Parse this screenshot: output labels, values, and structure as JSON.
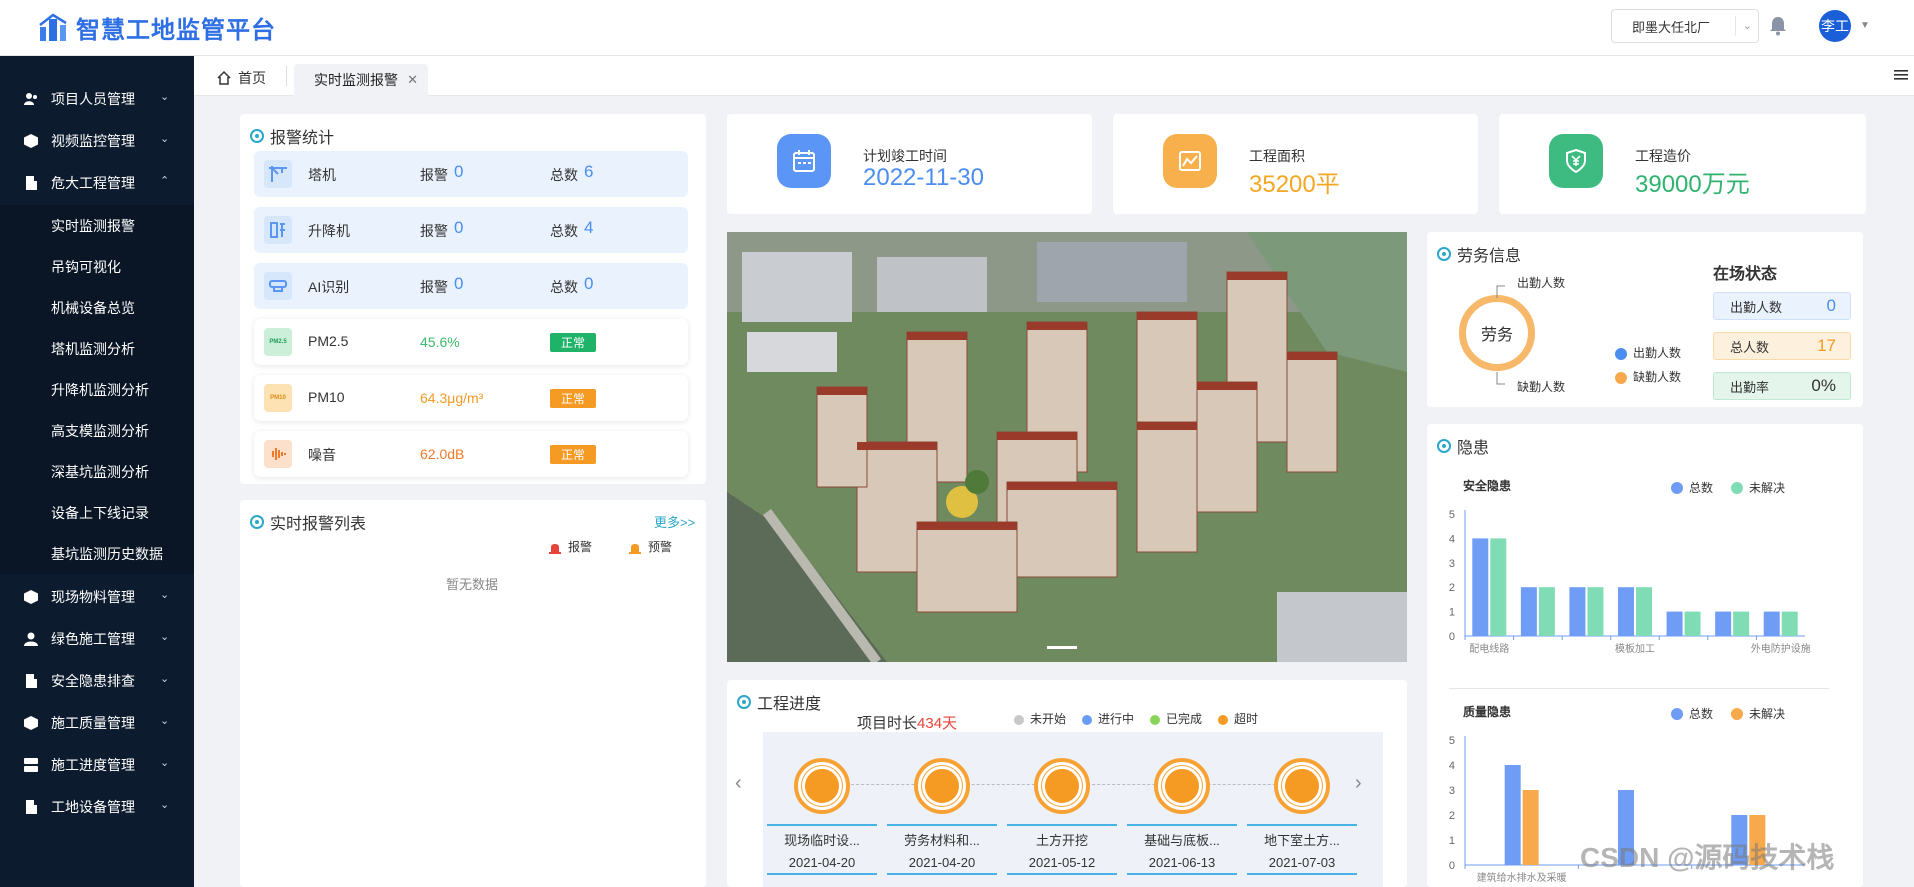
{
  "header": {
    "app_title": "智慧工地监管平台",
    "site_selector": "即墨大任北厂",
    "user": "李工"
  },
  "sidebar": {
    "items": [
      {
        "label": "项目人员管理"
      },
      {
        "label": "视频监控管理"
      },
      {
        "label": "危大工程管理"
      },
      {
        "label": "现场物料管理"
      },
      {
        "label": "绿色施工管理"
      },
      {
        "label": "安全隐患排查"
      },
      {
        "label": "施工质量管理"
      },
      {
        "label": "施工进度管理"
      },
      {
        "label": "工地设备管理"
      }
    ],
    "sub_items": [
      "实时监测报警",
      "吊钩可视化",
      "机械设备总览",
      "塔机监测分析",
      "升降机监测分析",
      "高支模监测分析",
      "深基坑监测分析",
      "设备上下线记录",
      "基坑监测历史数据"
    ]
  },
  "tabs": {
    "home": "首页",
    "active": "实时监测报警"
  },
  "alarm_stats": {
    "title": "报警统计",
    "alarm_key": "报警",
    "total_key": "总数",
    "devices": [
      {
        "name": "塔机",
        "alarm": "0",
        "total": "6"
      },
      {
        "name": "升降机",
        "alarm": "0",
        "total": "4"
      },
      {
        "name": "AI识别",
        "alarm": "0",
        "total": "0"
      }
    ],
    "env": [
      {
        "name": "PM2.5",
        "value": "45.6%",
        "status": "正常",
        "color": "#3dbb6c",
        "badge_color": "#1fb36a",
        "icon_text": "PM2.5"
      },
      {
        "name": "PM10",
        "value": "64.3μg/m³",
        "status": "正常",
        "color": "#f59a23",
        "badge_color": "#f59a23",
        "icon_text": "PM10"
      },
      {
        "name": "噪音",
        "value": "62.0dB",
        "status": "正常",
        "color": "#f07a2a",
        "badge_color": "#f59a23"
      }
    ]
  },
  "alarm_list": {
    "title": "实时报警列表",
    "more": "更多>>",
    "legend_alarm": "报警",
    "legend_warn": "预警",
    "empty": "暂无数据"
  },
  "top_stats": [
    {
      "label": "计划竣工时间",
      "value": "2022-11-30",
      "color": "#4b8ef0",
      "icon_bg": "#5b95f5"
    },
    {
      "label": "工程面积",
      "value": "35200平",
      "color": "#f5a623",
      "icon_bg": "#f8b04d"
    },
    {
      "label": "工程造价",
      "value": "39000万元",
      "color": "#2fb36f",
      "icon_bg": "#3dbb80"
    }
  ],
  "progress": {
    "title": "工程进度",
    "duration_prefix": "项目时长",
    "duration_value": "434天",
    "legend": [
      {
        "label": "未开始",
        "color": "#c8c8c8"
      },
      {
        "label": "进行中",
        "color": "#6b9cf5"
      },
      {
        "label": "已完成",
        "color": "#8bd35a"
      },
      {
        "label": "超时",
        "color": "#f59a23"
      }
    ],
    "nodes": [
      {
        "name": "现场临时设...",
        "date": "2021-04-20"
      },
      {
        "name": "劳务材料和...",
        "date": "2021-04-20"
      },
      {
        "name": "土方开挖",
        "date": "2021-05-12"
      },
      {
        "name": "基础与底板...",
        "date": "2021-06-13"
      },
      {
        "name": "地下室土方...",
        "date": "2021-07-03"
      }
    ]
  },
  "labor": {
    "title": "劳务信息",
    "donut_label": "劳务",
    "callout_top": "出勤人数",
    "callout_bottom": "缺勤人数",
    "legend": [
      {
        "label": "出勤人数",
        "color": "#4b8ef0"
      },
      {
        "label": "缺勤人数",
        "color": "#f8a94c"
      }
    ],
    "status_title": "在场状态",
    "status": [
      {
        "label": "出勤人数",
        "value": "0",
        "bg": "#eaf2fd",
        "color": "#4b8ef0"
      },
      {
        "label": "总人数",
        "value": "17",
        "bg": "#fdf1dd",
        "color": "#f59a23"
      },
      {
        "label": "出勤率",
        "value": "0%",
        "bg": "#e4f6ec",
        "color": "#333333"
      }
    ]
  },
  "hazard": {
    "title": "隐患"
  },
  "chart_data": [
    {
      "type": "bar",
      "title": "安全隐患",
      "categories": [
        "配电线路",
        "c2",
        "c3",
        "模板加工",
        "c5",
        "c6",
        "外电防护设施"
      ],
      "tick_labels": [
        "配电线路",
        "模板加工",
        "外电防护设施"
      ],
      "series": [
        {
          "name": "总数",
          "values": [
            4,
            2,
            2,
            2,
            1,
            1,
            1
          ],
          "color": "#6f9cf4"
        },
        {
          "name": "未解决",
          "values": [
            4,
            2,
            2,
            2,
            1,
            1,
            1
          ],
          "color": "#7fdcb4"
        }
      ],
      "ylim": [
        0,
        5
      ],
      "yticks": [
        0,
        1,
        2,
        3,
        4,
        5
      ]
    },
    {
      "type": "bar",
      "title": "质量隐患",
      "categories": [
        "建筑给水排水及采暖",
        "c2",
        "c3"
      ],
      "tick_labels": [
        "建筑给水排水及采暖"
      ],
      "series": [
        {
          "name": "总数",
          "values": [
            4,
            3,
            2
          ],
          "color": "#6f9cf4"
        },
        {
          "name": "未解决",
          "values": [
            3,
            0,
            2
          ],
          "color": "#f8a94c"
        }
      ],
      "ylim": [
        0,
        5
      ],
      "yticks": [
        0,
        1,
        2,
        3,
        4,
        5
      ]
    }
  ],
  "watermark": "CSDN @源码技术栈"
}
